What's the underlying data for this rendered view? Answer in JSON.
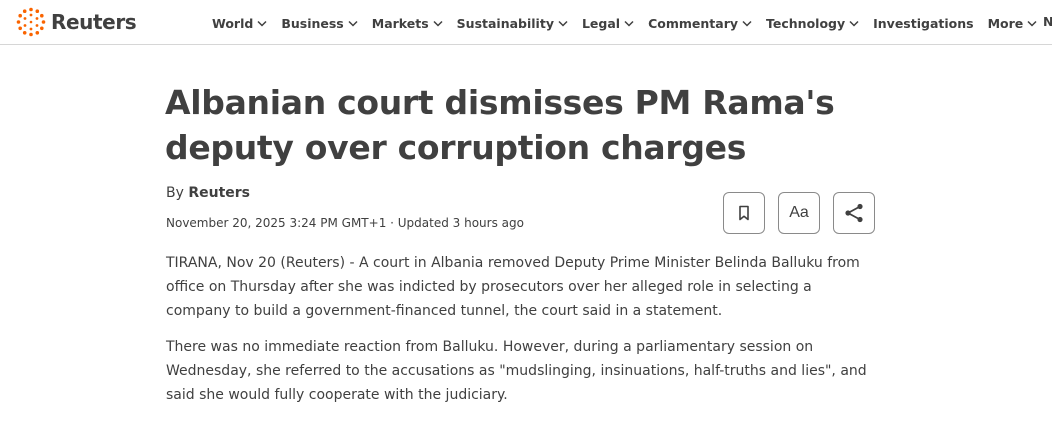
{
  "header": {
    "logo_text": "Reuters",
    "nav": [
      {
        "label": "World",
        "has_dropdown": true
      },
      {
        "label": "Business",
        "has_dropdown": true
      },
      {
        "label": "Markets",
        "has_dropdown": true
      },
      {
        "label": "Sustainability",
        "has_dropdown": true
      },
      {
        "label": "Legal",
        "has_dropdown": true
      },
      {
        "label": "Commentary",
        "has_dropdown": true
      },
      {
        "label": "Technology",
        "has_dropdown": true
      },
      {
        "label": "Investigations",
        "has_dropdown": false
      },
      {
        "label": "More",
        "has_dropdown": true
      }
    ],
    "nav_overflow_text": "N"
  },
  "article": {
    "headline": "Albanian court dismisses PM Rama's deputy over corruption charges",
    "byline_prefix": "By",
    "byline_author": "Reuters",
    "dateline": "November 20, 2025 3:24 PM GMT+1 · Updated 3 hours ago",
    "tools": {
      "bookmark_icon": "bookmark-icon",
      "text_size_label": "Aa",
      "share_icon": "share-icon"
    },
    "paragraphs": [
      "TIRANA, Nov 20 (Reuters) - A court in Albania removed Deputy Prime Minister Belinda Balluku from office on Thursday after she was indicted by prosecutors over her alleged role in selecting a company to build a government-financed tunnel, the court said in a statement.",
      "There was no immediate reaction from Balluku. However, during a parliamentary session on Wednesday, she referred to the accusations as \"mudslinging, insinuations, half-truths and lies\", and said she would fully cooperate with the judiciary."
    ]
  },
  "colors": {
    "logo_orange": "#fa6400",
    "text": "#404040",
    "divider": "#d6d6d6"
  }
}
